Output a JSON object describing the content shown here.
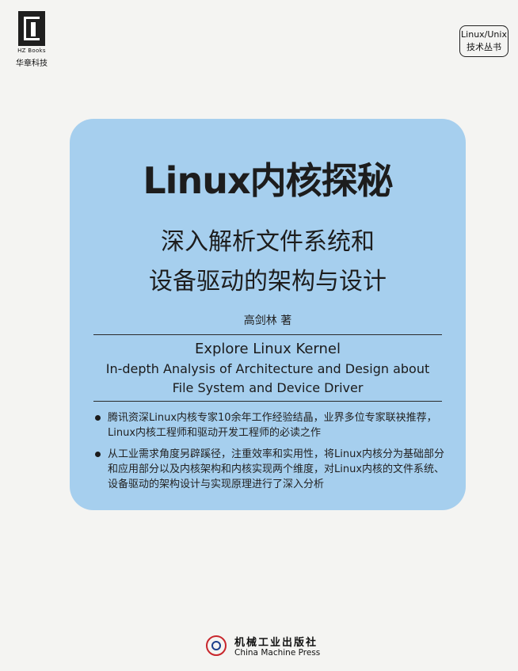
{
  "brand": {
    "logo_text": "HZ Books",
    "name": "华章科技"
  },
  "series": {
    "line1": "Linux/Unix",
    "line2": "技术丛书"
  },
  "cover": {
    "title": "Linux内核探秘",
    "subtitle_line1": "深入解析文件系统和",
    "subtitle_line2": "设备驱动的架构与设计",
    "author": "高剑林  著",
    "english_title": "Explore Linux Kernel",
    "english_subtitle_line1": "In-depth Analysis of Architecture and Design about",
    "english_subtitle_line2": "File System and Device Driver",
    "bullets": [
      "腾讯资深Linux内核专家10余年工作经验结晶，业界多位专家联袂推荐，Linux内核工程师和驱动开发工程师的必读之作",
      "从工业需求角度另辟蹊径，注重效率和实用性，将Linux内核分为基础部分和应用部分以及内核架构和内核实现两个维度，对Linux内核的文件系统、设备驱动的架构设计与实现原理进行了深入分析"
    ]
  },
  "publisher": {
    "name_cn": "机械工业出版社",
    "name_en": "China Machine Press"
  },
  "colors": {
    "panel": "#a6cfee",
    "background": "#f4f4f2",
    "text": "#1d1d1d"
  }
}
